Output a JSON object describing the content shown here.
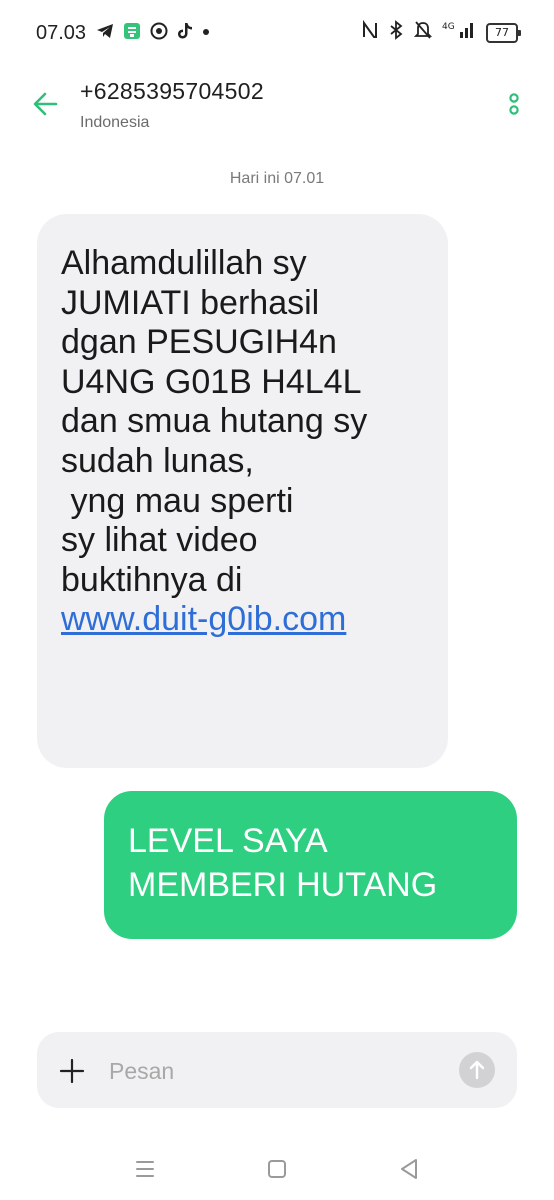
{
  "status_bar": {
    "time": "07.03",
    "left_icons": [
      "telegram-icon",
      "wechat-like-icon",
      "chrome-icon",
      "tiktok-icon",
      "dot-icon"
    ],
    "right_icons": [
      "nfc-icon",
      "bluetooth-icon",
      "mute-bell-icon",
      "signal-4g-icon"
    ],
    "network_label": "4G",
    "battery": "77"
  },
  "header": {
    "contact_number": "+6285395704502",
    "contact_country": "Indonesia"
  },
  "conversation": {
    "date_label": "Hari ini 07.01",
    "incoming_message": {
      "text": "Alhamdulillah sy\nJUMIATI berhasil\ndgan PESUGIH4n\nU4NG G01B H4L4L\ndan smua hutang sy\nsudah lunas,\n yng mau sperti\nsy lihat video\nbuktihnya di",
      "link": "www.duit-g0ib.com"
    },
    "outgoing_message": {
      "text": "LEVEL SAYA\nMEMBERI HUTANG"
    }
  },
  "composer": {
    "placeholder": "Pesan",
    "value": ""
  },
  "colors": {
    "accent": "#2fcf82",
    "incoming_bubble": "#f1f1f3",
    "link": "#2e6ed6",
    "back_arrow": "#2fbf7a"
  }
}
